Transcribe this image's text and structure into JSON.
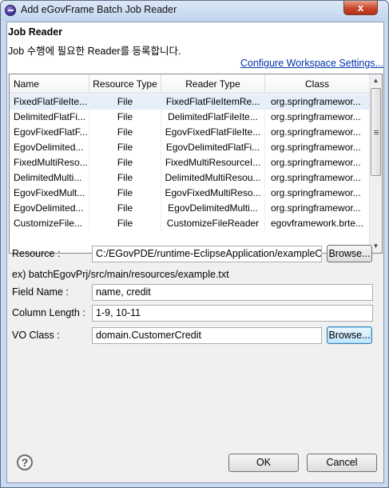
{
  "window": {
    "title": "Add eGovFrame Batch Job Reader",
    "close_label": "x"
  },
  "banner": {
    "title": "Job Reader",
    "description": "Job 수행에 필요한 Reader를 등록합니다.",
    "config_link": "Configure Workspace Settings..."
  },
  "table": {
    "columns": [
      "Name",
      "Resource Type",
      "Reader Type",
      "Class"
    ],
    "rows": [
      [
        "FixedFlatFileIte...",
        "File",
        "FixedFlatFileItemRe...",
        "org.springframewor..."
      ],
      [
        "DelimitedFlatFi...",
        "File",
        "DelimitedFlatFileIte...",
        "org.springframewor..."
      ],
      [
        "EgovFixedFlatF...",
        "File",
        "EgovFixedFlatFileIte...",
        "org.springframewor..."
      ],
      [
        "EgovDelimited...",
        "File",
        "EgovDelimitedFlatFi...",
        "org.springframewor..."
      ],
      [
        "FixedMultiReso...",
        "File",
        "FixedMultiResourceI...",
        "org.springframewor..."
      ],
      [
        "DelimitedMulti...",
        "File",
        "DelimitedMultiResou...",
        "org.springframewor..."
      ],
      [
        "EgovFixedMult...",
        "File",
        "EgovFixedMultiReso...",
        "org.springframewor..."
      ],
      [
        "EgovDelimited...",
        "File",
        "EgovDelimitedMulti...",
        "org.springframewor..."
      ],
      [
        "CustomizeFile...",
        "File",
        "CustomizeFileReader",
        "egovframework.brte..."
      ]
    ]
  },
  "form": {
    "resource_label": "Resource :",
    "resource_value": "C:/EGovPDE/runtime-EclipseApplication/exampleOne",
    "browse_label": "Browse...",
    "example_text": "ex) batchEgovPrj/src/main/resources/example.txt",
    "field_name_label": "Field Name :",
    "field_name_value": "name, credit",
    "column_length_label": "Column Length :",
    "column_length_value": "1-9, 10-11",
    "vo_class_label": "VO Class :",
    "vo_class_value": "domain.CustomerCredit",
    "vo_browse_label": "Browse..."
  },
  "footer": {
    "help_label": "?",
    "ok_label": "OK",
    "cancel_label": "Cancel"
  }
}
